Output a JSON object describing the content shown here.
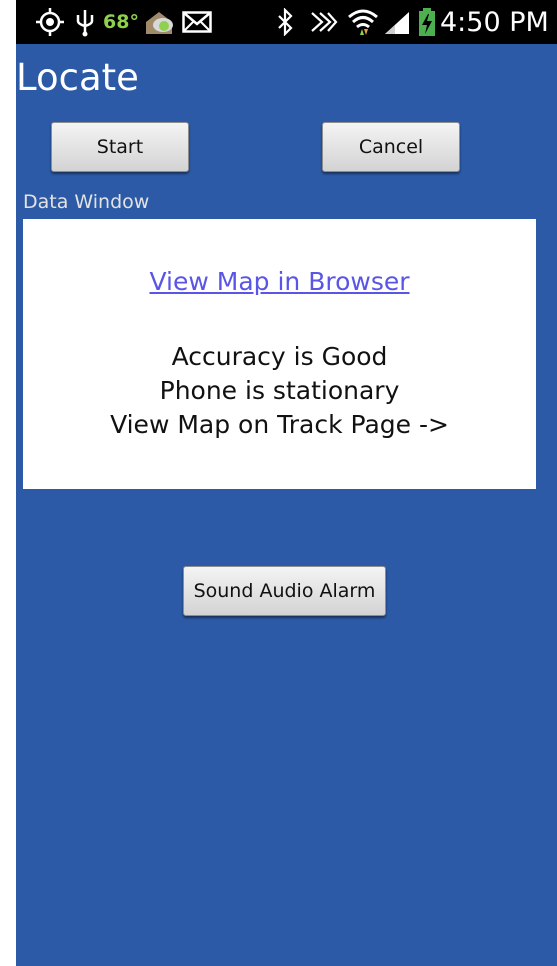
{
  "status_bar": {
    "temperature": "68°",
    "time": "4:50 PM",
    "icons": [
      "gps-target-icon",
      "usb-icon",
      "weather-icon",
      "email-icon",
      "bluetooth-icon",
      "nfc-icon",
      "wifi-icon",
      "signal-icon",
      "battery-charging-icon"
    ],
    "colors": {
      "background": "#000000",
      "temperature": "#8fd14f",
      "battery": "#4caf50"
    }
  },
  "app": {
    "title": "Locate",
    "background_color": "#2c5aa7"
  },
  "controls": {
    "start_label": "Start",
    "cancel_label": "Cancel"
  },
  "data_window": {
    "label": "Data Window",
    "link_text": "View Map in Browser",
    "lines": [
      "Accuracy is Good",
      "Phone is stationary",
      "View Map on Track Page ->"
    ],
    "link_color": "#5a55e6"
  },
  "alarm": {
    "button_label": "Sound Audio Alarm"
  }
}
